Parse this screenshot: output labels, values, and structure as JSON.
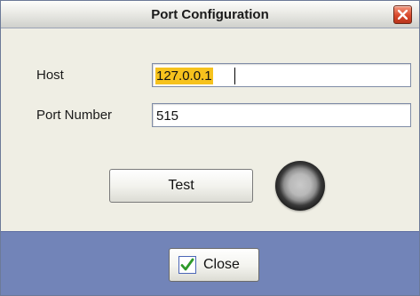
{
  "window": {
    "title": "Port Configuration",
    "close_icon": "close-x-icon"
  },
  "form": {
    "host_label": "Host",
    "host_value": "127.0.0.1",
    "port_label": "Port Number",
    "port_value": "515"
  },
  "actions": {
    "test_label": "Test",
    "status_indicator": "status-led-icon",
    "close_label": "Close",
    "close_icon": "checkmark-icon"
  },
  "colors": {
    "dialog_background": "#efeee4",
    "bottom_bar": "#7284b8",
    "selection_highlight": "#f6c21d",
    "close_x_button": "#d8482b",
    "checkmark": "#2e9a2a"
  }
}
